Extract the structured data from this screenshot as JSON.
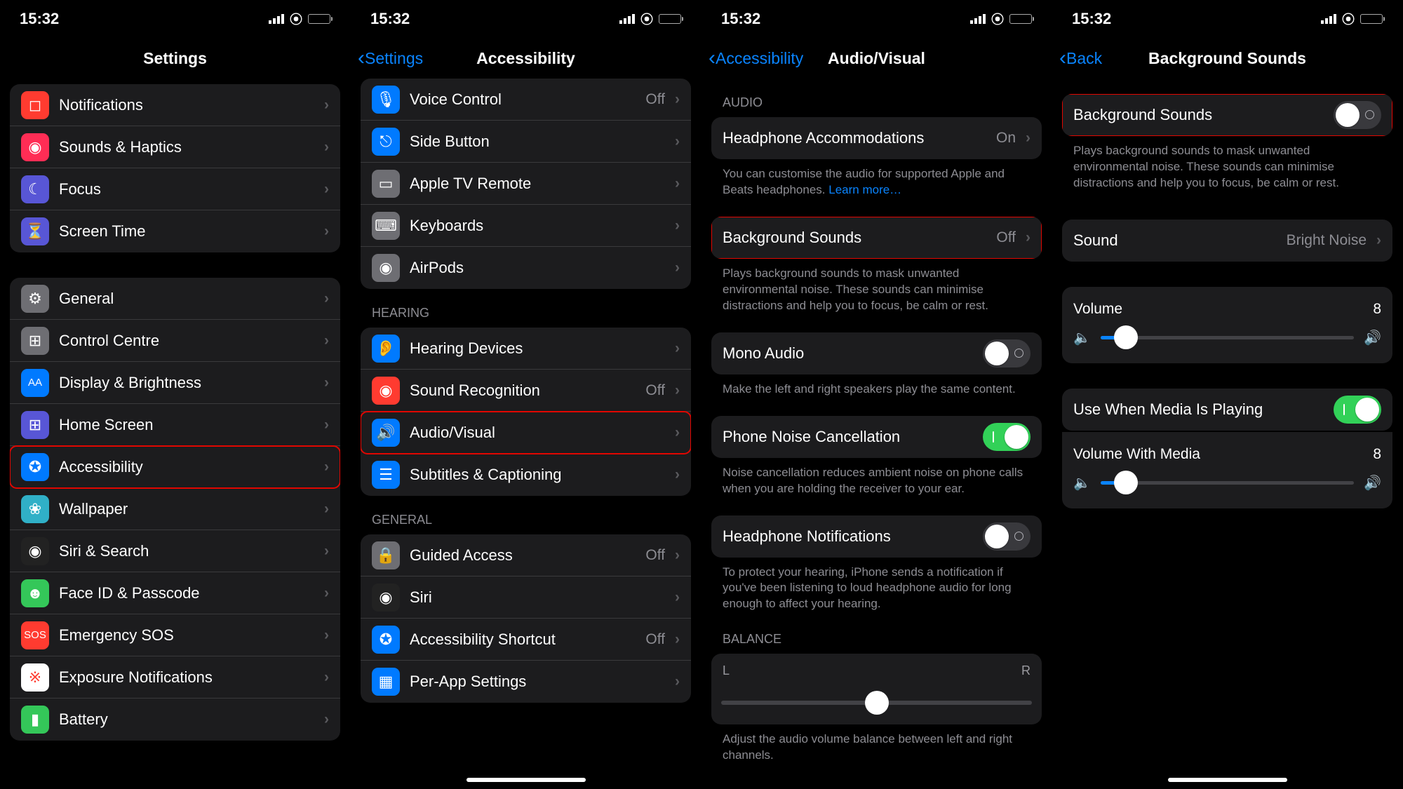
{
  "status": {
    "time": "15:32"
  },
  "s1": {
    "title": "Settings",
    "rows1": [
      {
        "icon": "◻",
        "color": "#ff3b30",
        "label": "Notifications",
        "name": "notifications"
      },
      {
        "icon": "◉",
        "color": "#ff2d55",
        "label": "Sounds & Haptics",
        "name": "sounds-haptics"
      },
      {
        "icon": "☾",
        "color": "#5856d6",
        "label": "Focus",
        "name": "focus"
      },
      {
        "icon": "⏳",
        "color": "#5856d6",
        "label": "Screen Time",
        "name": "screen-time"
      }
    ],
    "rows2": [
      {
        "icon": "⚙",
        "color": "#6e6e73",
        "label": "General",
        "name": "general"
      },
      {
        "icon": "⊞",
        "color": "#6e6e73",
        "label": "Control Centre",
        "name": "control-centre"
      },
      {
        "icon": "AA",
        "color": "#007aff",
        "label": "Display & Brightness",
        "name": "display-brightness"
      },
      {
        "icon": "⊞",
        "color": "#5856d6",
        "label": "Home Screen",
        "name": "home-screen"
      },
      {
        "icon": "✪",
        "color": "#007aff",
        "label": "Accessibility",
        "name": "accessibility",
        "hl": true
      },
      {
        "icon": "❀",
        "color": "#30b0c7",
        "label": "Wallpaper",
        "name": "wallpaper"
      },
      {
        "icon": "◉",
        "color": "#222",
        "label": "Siri & Search",
        "name": "siri-search"
      },
      {
        "icon": "☻",
        "color": "#34c759",
        "label": "Face ID & Passcode",
        "name": "face-id"
      },
      {
        "icon": "SOS",
        "color": "#ff3b30",
        "label": "Emergency SOS",
        "name": "emergency-sos"
      },
      {
        "icon": "※",
        "color": "#fff",
        "textcolor": "#ff3b30",
        "label": "Exposure Notifications",
        "name": "exposure"
      },
      {
        "icon": "▮",
        "color": "#34c759",
        "label": "Battery",
        "name": "battery"
      }
    ]
  },
  "s2": {
    "back": "Settings",
    "title": "Accessibility",
    "pmg": [
      {
        "icon": "🎙",
        "color": "#007aff",
        "label": "Voice Control",
        "val": "Off",
        "name": "voice-control"
      },
      {
        "icon": "⎋",
        "color": "#007aff",
        "label": "Side Button",
        "name": "side-button"
      },
      {
        "icon": "▭",
        "color": "#6e6e73",
        "label": "Apple TV Remote",
        "name": "apple-tv-remote"
      },
      {
        "icon": "⌨",
        "color": "#6e6e73",
        "label": "Keyboards",
        "name": "keyboards"
      },
      {
        "icon": "◉",
        "color": "#6e6e73",
        "label": "AirPods",
        "name": "airpods"
      }
    ],
    "hearing_header": "Hearing",
    "hearing": [
      {
        "icon": "👂",
        "color": "#007aff",
        "label": "Hearing Devices",
        "name": "hearing-devices"
      },
      {
        "icon": "◉",
        "color": "#ff3b30",
        "label": "Sound Recognition",
        "val": "Off",
        "name": "sound-recognition"
      },
      {
        "icon": "🔊",
        "color": "#007aff",
        "label": "Audio/Visual",
        "name": "audio-visual",
        "hl": true
      },
      {
        "icon": "☰",
        "color": "#007aff",
        "label": "Subtitles & Captioning",
        "name": "subtitles"
      }
    ],
    "general_header": "General",
    "general": [
      {
        "icon": "🔒",
        "color": "#6e6e73",
        "label": "Guided Access",
        "val": "Off",
        "name": "guided-access"
      },
      {
        "icon": "◉",
        "color": "#222",
        "label": "Siri",
        "name": "siri"
      },
      {
        "icon": "✪",
        "color": "#007aff",
        "label": "Accessibility Shortcut",
        "val": "Off",
        "name": "shortcut"
      },
      {
        "icon": "▦",
        "color": "#007aff",
        "label": "Per-App Settings",
        "name": "per-app"
      }
    ]
  },
  "s3": {
    "back": "Accessibility",
    "title": "Audio/Visual",
    "audio_header": "Audio",
    "headphone_acc": {
      "label": "Headphone Accommodations",
      "val": "On"
    },
    "headphone_caption": "You can customise the audio for supported Apple and Beats headphones.",
    "learn_more": "Learn more…",
    "bg_sounds": {
      "label": "Background Sounds",
      "val": "Off"
    },
    "bg_caption": "Plays background sounds to mask unwanted environmental noise. These sounds can minimise distractions and help you to focus, be calm or rest.",
    "mono": {
      "label": "Mono Audio"
    },
    "mono_caption": "Make the left and right speakers play the same content.",
    "noise": {
      "label": "Phone Noise Cancellation"
    },
    "noise_caption": "Noise cancellation reduces ambient noise on phone calls when you are holding the receiver to your ear.",
    "hp_notif": {
      "label": "Headphone Notifications"
    },
    "hp_notif_caption": "To protect your hearing, iPhone sends a notification if you've been listening to loud headphone audio for long enough to affect your hearing.",
    "balance_header": "Balance",
    "bal_left": "L",
    "bal_right": "R",
    "balance_caption": "Adjust the audio volume balance between left and right channels."
  },
  "s4": {
    "back": "Back",
    "title": "Background Sounds",
    "bg_toggle": {
      "label": "Background Sounds"
    },
    "bg_caption": "Plays background sounds to mask unwanted environmental noise. These sounds can minimise distractions and help you to focus, be calm or rest.",
    "sound_row": {
      "label": "Sound",
      "val": "Bright Noise"
    },
    "vol_label": "Volume",
    "vol_val": "8",
    "media_toggle": {
      "label": "Use When Media Is Playing"
    },
    "vol_media_label": "Volume With Media",
    "vol_media_val": "8"
  }
}
